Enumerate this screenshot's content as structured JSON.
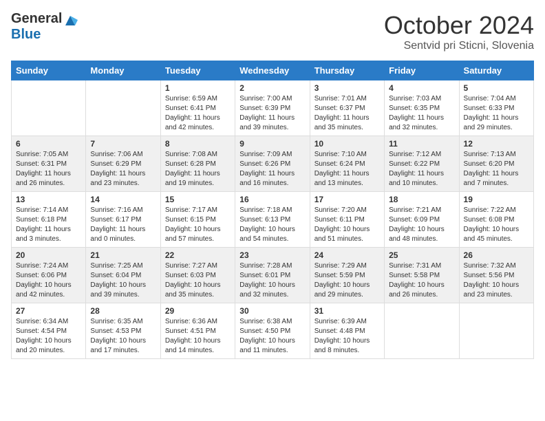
{
  "header": {
    "logo_general": "General",
    "logo_blue": "Blue",
    "month_title": "October 2024",
    "location": "Sentvid pri Sticni, Slovenia"
  },
  "days_of_week": [
    "Sunday",
    "Monday",
    "Tuesday",
    "Wednesday",
    "Thursday",
    "Friday",
    "Saturday"
  ],
  "weeks": [
    [
      {
        "day": "",
        "sunrise": "",
        "sunset": "",
        "daylight": ""
      },
      {
        "day": "",
        "sunrise": "",
        "sunset": "",
        "daylight": ""
      },
      {
        "day": "1",
        "sunrise": "Sunrise: 6:59 AM",
        "sunset": "Sunset: 6:41 PM",
        "daylight": "Daylight: 11 hours and 42 minutes."
      },
      {
        "day": "2",
        "sunrise": "Sunrise: 7:00 AM",
        "sunset": "Sunset: 6:39 PM",
        "daylight": "Daylight: 11 hours and 39 minutes."
      },
      {
        "day": "3",
        "sunrise": "Sunrise: 7:01 AM",
        "sunset": "Sunset: 6:37 PM",
        "daylight": "Daylight: 11 hours and 35 minutes."
      },
      {
        "day": "4",
        "sunrise": "Sunrise: 7:03 AM",
        "sunset": "Sunset: 6:35 PM",
        "daylight": "Daylight: 11 hours and 32 minutes."
      },
      {
        "day": "5",
        "sunrise": "Sunrise: 7:04 AM",
        "sunset": "Sunset: 6:33 PM",
        "daylight": "Daylight: 11 hours and 29 minutes."
      }
    ],
    [
      {
        "day": "6",
        "sunrise": "Sunrise: 7:05 AM",
        "sunset": "Sunset: 6:31 PM",
        "daylight": "Daylight: 11 hours and 26 minutes."
      },
      {
        "day": "7",
        "sunrise": "Sunrise: 7:06 AM",
        "sunset": "Sunset: 6:29 PM",
        "daylight": "Daylight: 11 hours and 23 minutes."
      },
      {
        "day": "8",
        "sunrise": "Sunrise: 7:08 AM",
        "sunset": "Sunset: 6:28 PM",
        "daylight": "Daylight: 11 hours and 19 minutes."
      },
      {
        "day": "9",
        "sunrise": "Sunrise: 7:09 AM",
        "sunset": "Sunset: 6:26 PM",
        "daylight": "Daylight: 11 hours and 16 minutes."
      },
      {
        "day": "10",
        "sunrise": "Sunrise: 7:10 AM",
        "sunset": "Sunset: 6:24 PM",
        "daylight": "Daylight: 11 hours and 13 minutes."
      },
      {
        "day": "11",
        "sunrise": "Sunrise: 7:12 AM",
        "sunset": "Sunset: 6:22 PM",
        "daylight": "Daylight: 11 hours and 10 minutes."
      },
      {
        "day": "12",
        "sunrise": "Sunrise: 7:13 AM",
        "sunset": "Sunset: 6:20 PM",
        "daylight": "Daylight: 11 hours and 7 minutes."
      }
    ],
    [
      {
        "day": "13",
        "sunrise": "Sunrise: 7:14 AM",
        "sunset": "Sunset: 6:18 PM",
        "daylight": "Daylight: 11 hours and 3 minutes."
      },
      {
        "day": "14",
        "sunrise": "Sunrise: 7:16 AM",
        "sunset": "Sunset: 6:17 PM",
        "daylight": "Daylight: 11 hours and 0 minutes."
      },
      {
        "day": "15",
        "sunrise": "Sunrise: 7:17 AM",
        "sunset": "Sunset: 6:15 PM",
        "daylight": "Daylight: 10 hours and 57 minutes."
      },
      {
        "day": "16",
        "sunrise": "Sunrise: 7:18 AM",
        "sunset": "Sunset: 6:13 PM",
        "daylight": "Daylight: 10 hours and 54 minutes."
      },
      {
        "day": "17",
        "sunrise": "Sunrise: 7:20 AM",
        "sunset": "Sunset: 6:11 PM",
        "daylight": "Daylight: 10 hours and 51 minutes."
      },
      {
        "day": "18",
        "sunrise": "Sunrise: 7:21 AM",
        "sunset": "Sunset: 6:09 PM",
        "daylight": "Daylight: 10 hours and 48 minutes."
      },
      {
        "day": "19",
        "sunrise": "Sunrise: 7:22 AM",
        "sunset": "Sunset: 6:08 PM",
        "daylight": "Daylight: 10 hours and 45 minutes."
      }
    ],
    [
      {
        "day": "20",
        "sunrise": "Sunrise: 7:24 AM",
        "sunset": "Sunset: 6:06 PM",
        "daylight": "Daylight: 10 hours and 42 minutes."
      },
      {
        "day": "21",
        "sunrise": "Sunrise: 7:25 AM",
        "sunset": "Sunset: 6:04 PM",
        "daylight": "Daylight: 10 hours and 39 minutes."
      },
      {
        "day": "22",
        "sunrise": "Sunrise: 7:27 AM",
        "sunset": "Sunset: 6:03 PM",
        "daylight": "Daylight: 10 hours and 35 minutes."
      },
      {
        "day": "23",
        "sunrise": "Sunrise: 7:28 AM",
        "sunset": "Sunset: 6:01 PM",
        "daylight": "Daylight: 10 hours and 32 minutes."
      },
      {
        "day": "24",
        "sunrise": "Sunrise: 7:29 AM",
        "sunset": "Sunset: 5:59 PM",
        "daylight": "Daylight: 10 hours and 29 minutes."
      },
      {
        "day": "25",
        "sunrise": "Sunrise: 7:31 AM",
        "sunset": "Sunset: 5:58 PM",
        "daylight": "Daylight: 10 hours and 26 minutes."
      },
      {
        "day": "26",
        "sunrise": "Sunrise: 7:32 AM",
        "sunset": "Sunset: 5:56 PM",
        "daylight": "Daylight: 10 hours and 23 minutes."
      }
    ],
    [
      {
        "day": "27",
        "sunrise": "Sunrise: 6:34 AM",
        "sunset": "Sunset: 4:54 PM",
        "daylight": "Daylight: 10 hours and 20 minutes."
      },
      {
        "day": "28",
        "sunrise": "Sunrise: 6:35 AM",
        "sunset": "Sunset: 4:53 PM",
        "daylight": "Daylight: 10 hours and 17 minutes."
      },
      {
        "day": "29",
        "sunrise": "Sunrise: 6:36 AM",
        "sunset": "Sunset: 4:51 PM",
        "daylight": "Daylight: 10 hours and 14 minutes."
      },
      {
        "day": "30",
        "sunrise": "Sunrise: 6:38 AM",
        "sunset": "Sunset: 4:50 PM",
        "daylight": "Daylight: 10 hours and 11 minutes."
      },
      {
        "day": "31",
        "sunrise": "Sunrise: 6:39 AM",
        "sunset": "Sunset: 4:48 PM",
        "daylight": "Daylight: 10 hours and 8 minutes."
      },
      {
        "day": "",
        "sunrise": "",
        "sunset": "",
        "daylight": ""
      },
      {
        "day": "",
        "sunrise": "",
        "sunset": "",
        "daylight": ""
      }
    ]
  ]
}
